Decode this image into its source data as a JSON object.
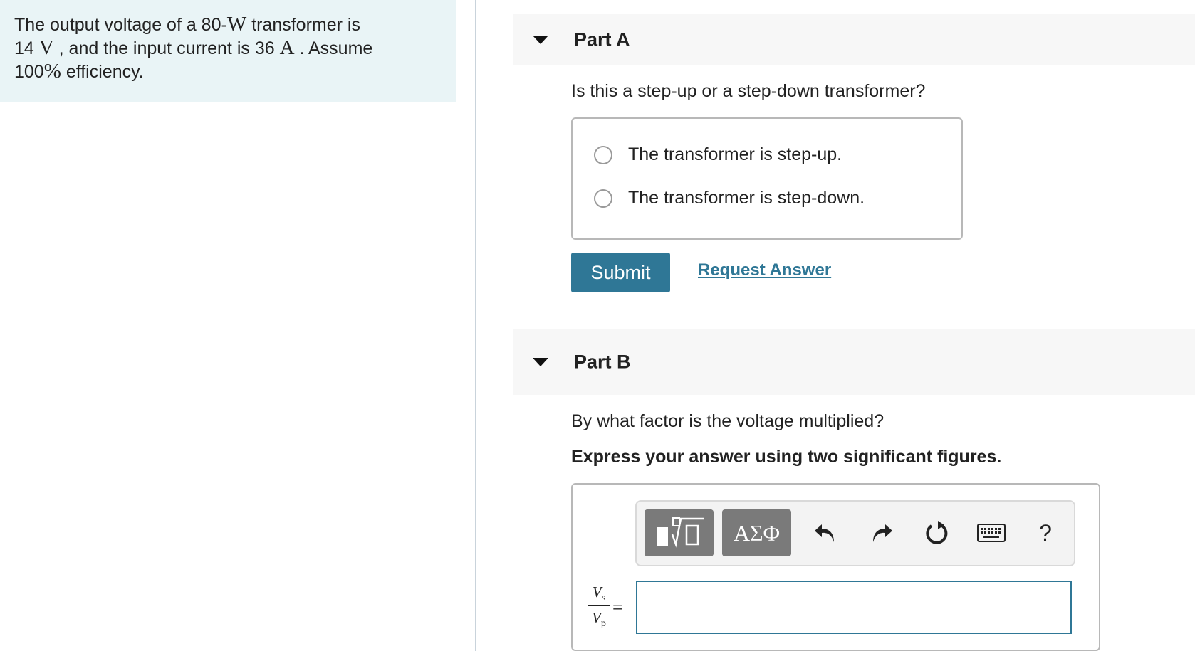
{
  "problem": {
    "line1_a": "The output voltage of a 80-",
    "line1_unit": "W",
    "line1_b": " transformer is",
    "line2_a": "14 ",
    "line2_unit": "V",
    "line2_b": " , and the input current is 36 ",
    "line2_unit2": "A",
    "line2_c": " . Assume",
    "line3_a": "100",
    "line3_pct": "%",
    "line3_b": " efficiency."
  },
  "partA": {
    "title": "Part A",
    "question": "Is this a step-up or a step-down transformer?",
    "choices": [
      "The transformer is step-up.",
      "The transformer is step-down."
    ],
    "submit_label": "Submit",
    "request_label": "Request Answer"
  },
  "partB": {
    "title": "Part B",
    "question": "By what factor is the voltage multiplied?",
    "instruction": "Express your answer using two significant figures.",
    "greek_label": "ΑΣΦ",
    "help_label": "?",
    "fraction_num": "V",
    "fraction_num_sub": "s",
    "fraction_den": "V",
    "fraction_den_sub": "p",
    "equals": "=",
    "answer_value": ""
  },
  "colors": {
    "accent": "#2f7796",
    "problem_bg": "#e9f4f6",
    "toolbar_button": "#7a7a7a"
  },
  "icons": [
    "collapse-arrow-icon",
    "templates-icon",
    "undo-icon",
    "redo-icon",
    "reset-icon",
    "keyboard-icon"
  ]
}
